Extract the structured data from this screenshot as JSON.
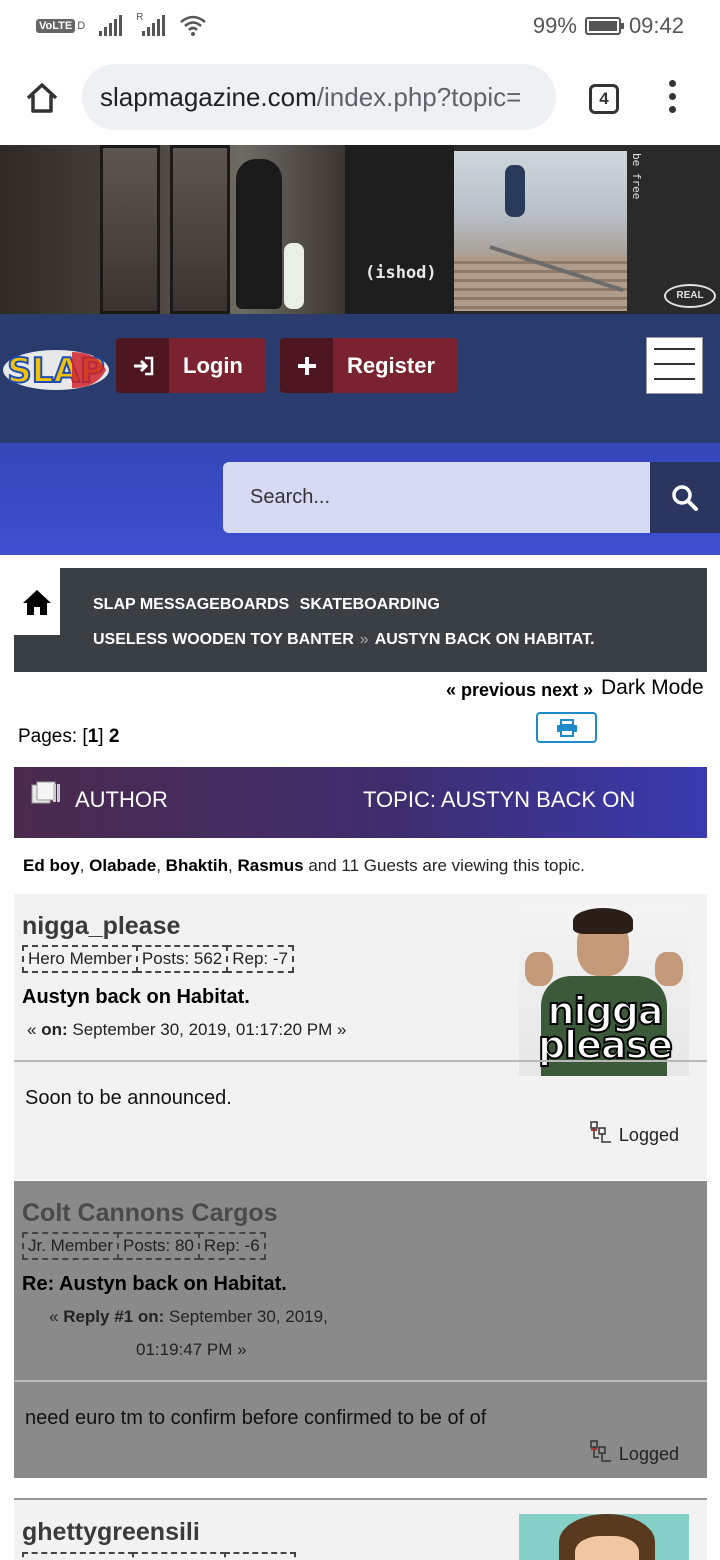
{
  "status_bar": {
    "volte": "VoLTE",
    "volte_sub": "D",
    "signal_r": "R",
    "battery": "99%",
    "time": "09:42"
  },
  "browser": {
    "url_host": "slapmagazine.com",
    "url_path": "/index.php?topic=",
    "tab_count": "4"
  },
  "banner": {
    "caption": "(ishod)",
    "side_text": "be free",
    "brand": "REAL"
  },
  "header": {
    "logo": "SLAP",
    "login_label": "Login",
    "register_label": "Register",
    "search_placeholder": "Search..."
  },
  "breadcrumb": {
    "items": [
      "SLAP MESSAGEBOARDS",
      "SKATEBOARDING",
      "USELESS WOODEN TOY BANTER",
      "AUSTYN BACK ON HABITAT."
    ],
    "separator": "»"
  },
  "topic_nav": {
    "prefix": "«",
    "previous": "previous",
    "next": "next",
    "suffix": "»",
    "dark_mode": "Dark Mode"
  },
  "pagination": {
    "label": "Pages:",
    "current": "1",
    "next_page": "2"
  },
  "topic_header": {
    "author_label": "AUTHOR",
    "topic_label": "TOPIC: AUSTYN BACK ON"
  },
  "viewers": {
    "users": [
      "Ed boy",
      "Olabade",
      "Bhaktih",
      "Rasmus"
    ],
    "suffix": "and 11 Guests are viewing this topic."
  },
  "posts": [
    {
      "author": "nigga_please",
      "rank": "Hero Member",
      "posts": "Posts: 562",
      "rep": "Rep: -7",
      "subject": "Austyn back on Habitat.",
      "meta_prefix": "« ",
      "meta_on": "on:",
      "meta_date": "September 30, 2019, 01:17:20 PM",
      "meta_suffix": " »",
      "body": "Soon to be announced.",
      "logged": "Logged",
      "avatar_text_1": "nigga",
      "avatar_text_2": "please"
    },
    {
      "author": "Colt Cannons Cargos",
      "rank": "Jr. Member",
      "posts": "Posts: 80",
      "rep": "Rep: -6",
      "subject": "Re: Austyn back on Habitat.",
      "meta_prefix": "« ",
      "meta_on": "Reply #1 on:",
      "meta_date_1": "September 30, 2019,",
      "meta_date_2": "01:19:47 PM",
      "meta_suffix": " »",
      "body": "need euro tm to confirm before confirmed to be of of",
      "logged": "Logged"
    },
    {
      "author": "ghettygreensili"
    }
  ],
  "colors": {
    "nav_band": "#2a3b6e",
    "search_band": "#3f4fd0",
    "button": "#7a2230",
    "breadcrumb_bg": "#3a3f44",
    "print_accent": "#1d8acc"
  }
}
